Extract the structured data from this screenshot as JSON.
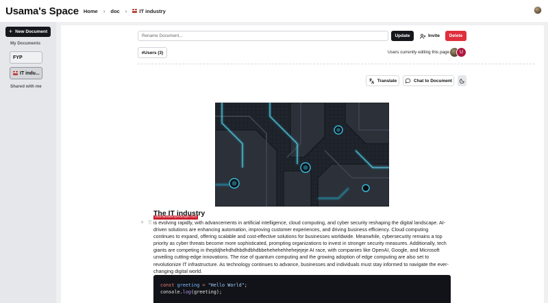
{
  "header": {
    "app_title": "Usama's Space",
    "breadcrumb": [
      "Home",
      "doc",
      "IT industry"
    ],
    "separator": "›"
  },
  "sidebar": {
    "new_document_label": "New Document",
    "my_documents_label": "My Documents",
    "documents": [
      {
        "label": "FYP",
        "active": false
      },
      {
        "label": "IT indu...",
        "active": true
      }
    ],
    "shared_label": "Shared with me"
  },
  "toolbar": {
    "rename_placeholder": "Rename Document...",
    "update_label": "Update",
    "invite_label": "Invite",
    "delete_label": "Delete"
  },
  "users": {
    "button_label": "#Users (3)",
    "editing_label": "Users currently editing this page",
    "avatar_initial": "U"
  },
  "actions": {
    "translate_label": "Translate",
    "chat_label": "Chat to Document"
  },
  "document": {
    "title": "The IT industry",
    "cursor_tag": "usamahaider@example.com",
    "paragraph": "is evolving rapidly, with advancements in artificial intelligence, cloud computing, and cyber security reshaping the digital landscape. AI-driven solutions are enhancing automation, improving customer experiences, and driving business efficiency. Cloud computing continues to expand, offering scalable and cost-effective solutions for businesses worldwide. Meanwhile, cybersecurity remains a top priority as cyber threats become more sophisticated, prompting organizations to invest in stronger security measures. Additionally, tech giants are competing in thejddjhehdhdhbdhdbhdbbehehehehhehejejeje AI race, with companies like OpenAI, Google, and Microsoft unveiling cutting-edge innovations. The rise of quantum computing and the growing adoption of edge computing are also set to revolutionize IT infrastructure. As technology continues to advance, businesses and individuals must stay informed to navigate the ever-changing digital world.",
    "code": {
      "line1": {
        "kw": "const",
        "var": "greeting",
        "op": "=",
        "str": "\"Hello World\"",
        "end": ";"
      },
      "line2": {
        "obj": "console.",
        "fn": "log",
        "args": "(greeting);"
      }
    }
  },
  "colors": {
    "primary_dark": "#15171c",
    "danger": "#df2f3c",
    "sidebar_bg": "#e6e7ea",
    "main_bg": "#eef0f2",
    "avatar_user": "#b0173f"
  }
}
